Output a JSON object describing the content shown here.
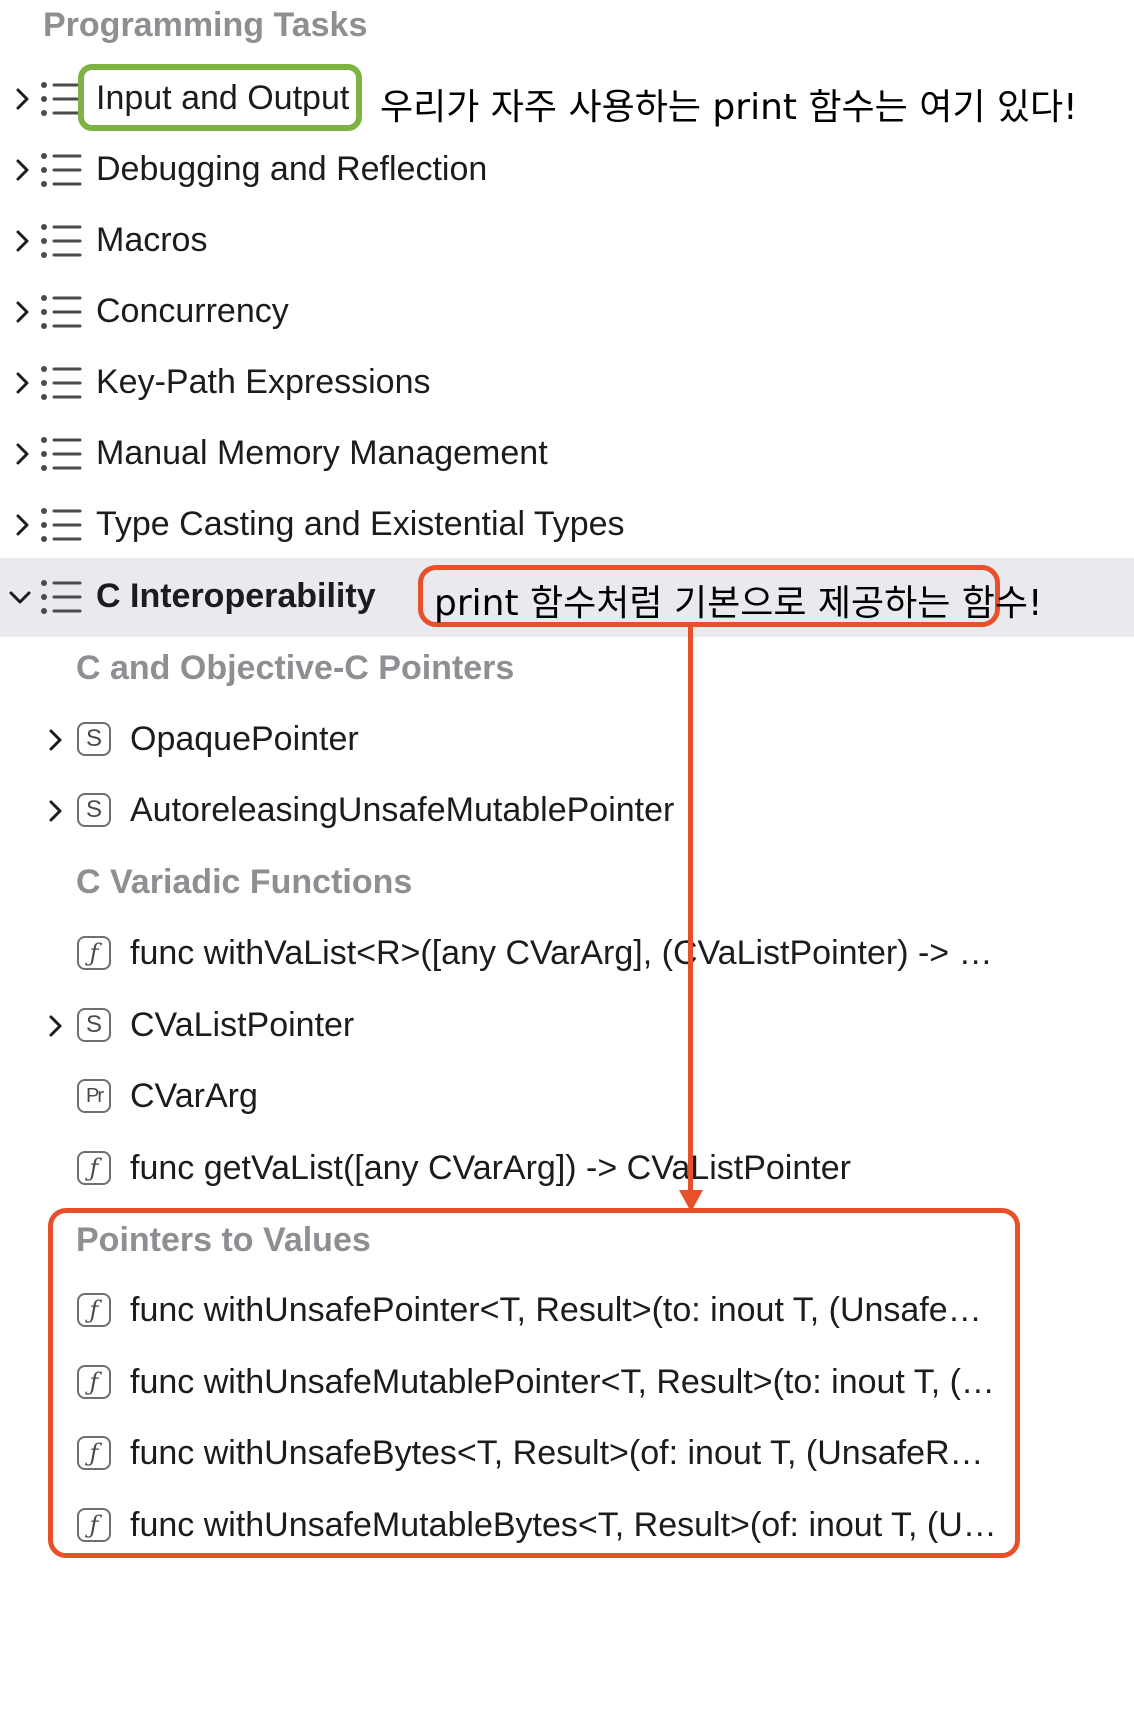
{
  "header": {
    "title": "Programming Tasks"
  },
  "top_items": [
    {
      "label": "Input and Output",
      "expanded": false
    },
    {
      "label": "Debugging and Reflection",
      "expanded": false
    },
    {
      "label": "Macros",
      "expanded": false
    },
    {
      "label": "Concurrency",
      "expanded": false
    },
    {
      "label": "Key-Path Expressions",
      "expanded": false
    },
    {
      "label": "Manual Memory Management",
      "expanded": false
    },
    {
      "label": "Type Casting and Existential Types",
      "expanded": false
    },
    {
      "label": "C Interoperability",
      "expanded": true
    }
  ],
  "c_interop": {
    "pointers_header": "C and Objective-C Pointers",
    "pointers_items": [
      {
        "icon": "S",
        "label": "OpaquePointer"
      },
      {
        "icon": "S",
        "label": "AutoreleasingUnsafeMutablePointer"
      }
    ],
    "variadic_header": "C Variadic Functions",
    "variadic_items": [
      {
        "icon": "ƒ",
        "label": "func withVaList<R>([any CVarArg], (CVaListPointer) -> R) -..."
      },
      {
        "icon": "S",
        "label": "CVaListPointer"
      },
      {
        "icon": "Pr",
        "label": "CVarArg"
      },
      {
        "icon": "ƒ",
        "label": "func getVaList([any CVarArg]) -> CVaListPointer"
      }
    ],
    "values_header": "Pointers to Values",
    "values_items": [
      {
        "icon": "ƒ",
        "label": "func withUnsafePointer<T, Result>(to: inout T, (UnsafePoin..."
      },
      {
        "icon": "ƒ",
        "label": "func withUnsafeMutablePointer<T, Result>(to: inout T, (Un..."
      },
      {
        "icon": "ƒ",
        "label": "func withUnsafeBytes<T, Result>(of: inout T, (UnsafeRawB..."
      },
      {
        "icon": "ƒ",
        "label": "func withUnsafeMutableBytes<T, Result>(of: inout T, (Unsa..."
      }
    ]
  },
  "annotations": {
    "input_output_note": "우리가 자주 사용하는 print 함수는 여기 있다!",
    "c_interop_note": "print 함수처럼 기본으로 제공하는 함수!"
  },
  "colors": {
    "green_highlight": "#7cb342",
    "red_highlight": "#e8502a",
    "selected_row": "#e9e9ee",
    "section_header": "#8e8e93"
  }
}
